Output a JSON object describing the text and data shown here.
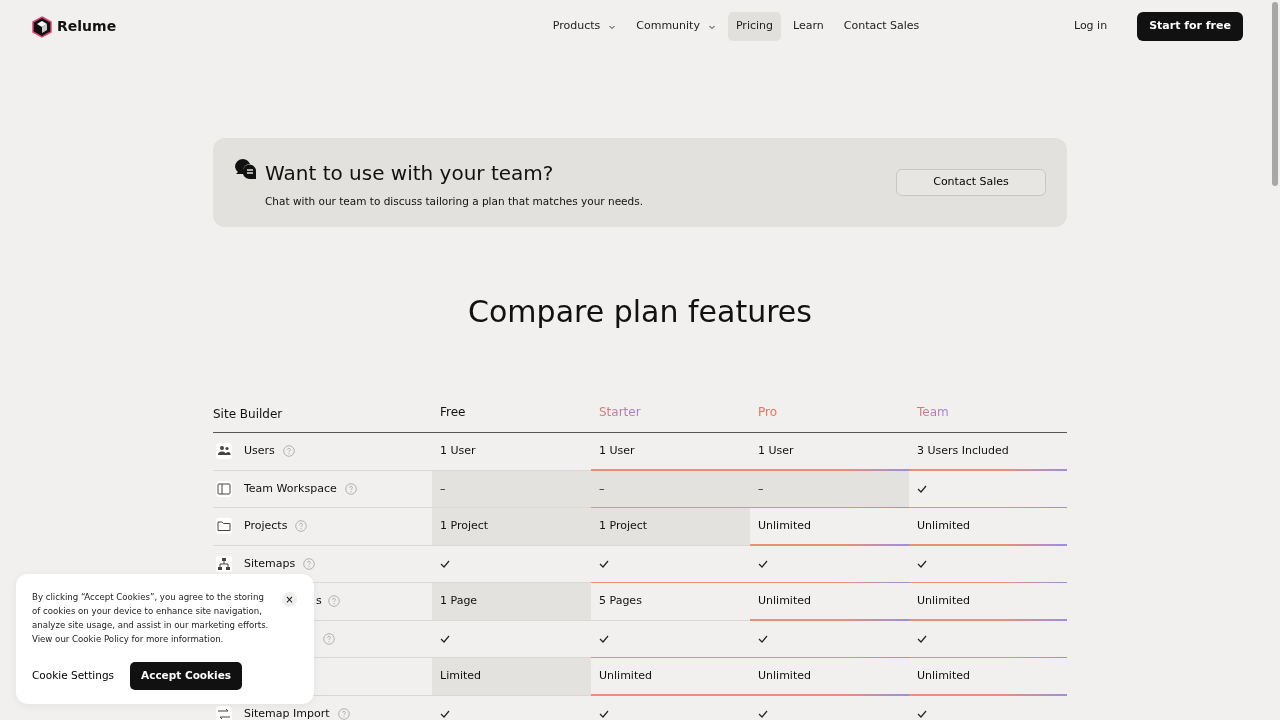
{
  "navbar": {
    "brand": "Relume",
    "links": [
      {
        "label": "Products",
        "dropdown": true,
        "selected": false
      },
      {
        "label": "Community",
        "dropdown": true,
        "selected": false
      },
      {
        "label": "Pricing",
        "dropdown": false,
        "selected": true
      },
      {
        "label": "Learn",
        "dropdown": false,
        "selected": false
      },
      {
        "label": "Contact Sales",
        "dropdown": false,
        "selected": false
      }
    ],
    "login": "Log in",
    "cta": "Start for free"
  },
  "team_banner": {
    "title": "Want to use with your team?",
    "text": "Chat with our team to discuss tailoring a plan that matches your needs.",
    "button": "Contact Sales"
  },
  "compare": {
    "title": "Compare plan features",
    "section": "Site Builder",
    "plans": [
      {
        "name": "Free",
        "kind": "plain"
      },
      {
        "name": "Starter",
        "kind": "starter"
      },
      {
        "name": "Pro",
        "kind": "pro"
      },
      {
        "name": "Team",
        "kind": "team"
      }
    ],
    "rows": [
      {
        "label": "Users",
        "help": true,
        "cells": [
          {
            "value": "1 User",
            "shaded": false,
            "accent": false
          },
          {
            "value": "1 User",
            "shaded": false,
            "accent": true
          },
          {
            "value": "1 User",
            "shaded": false,
            "accent": true
          },
          {
            "value": "3 Users Included",
            "shaded": false,
            "accent": true
          }
        ]
      },
      {
        "label": "Team Workspace",
        "help": true,
        "cells": [
          {
            "value": "–",
            "shaded": true,
            "accent": false
          },
          {
            "value": "–",
            "shaded": true,
            "accent": true
          },
          {
            "value": "–",
            "shaded": true,
            "accent": true
          },
          {
            "check": true,
            "shaded": false,
            "accent": true
          }
        ]
      },
      {
        "label": "Projects",
        "help": true,
        "cells": [
          {
            "value": "1 Project",
            "shaded": true,
            "accent": false
          },
          {
            "value": "1 Project",
            "shaded": true,
            "accent": false
          },
          {
            "value": "Unlimited",
            "shaded": false,
            "accent": true
          },
          {
            "value": "Unlimited",
            "shaded": false,
            "accent": true
          }
        ]
      },
      {
        "label": "Sitemaps",
        "help": true,
        "cells": [
          {
            "check": true,
            "shaded": false,
            "accent": false
          },
          {
            "check": true,
            "shaded": false,
            "accent": true
          },
          {
            "check": true,
            "shaded": false,
            "accent": true
          },
          {
            "check": true,
            "shaded": false,
            "accent": true
          }
        ]
      },
      {
        "label": "s",
        "help": true,
        "cells": [
          {
            "value": "1 Page",
            "shaded": true,
            "accent": false
          },
          {
            "value": "5 Pages",
            "shaded": false,
            "accent": false
          },
          {
            "value": "Unlimited",
            "shaded": false,
            "accent": true
          },
          {
            "value": "Unlimited",
            "shaded": false,
            "accent": true
          }
        ]
      },
      {
        "help": true,
        "cells": [
          {
            "check": true,
            "shaded": false,
            "accent": false
          },
          {
            "check": true,
            "shaded": false,
            "accent": true
          },
          {
            "check": true,
            "shaded": false,
            "accent": true
          },
          {
            "check": true,
            "shaded": false,
            "accent": true
          }
        ]
      },
      {
        "cells": [
          {
            "value": "Limited",
            "shaded": true,
            "accent": false
          },
          {
            "value": "Unlimited",
            "shaded": false,
            "accent": true
          },
          {
            "value": "Unlimited",
            "shaded": false,
            "accent": true
          },
          {
            "value": "Unlimited",
            "shaded": false,
            "accent": true
          }
        ]
      },
      {
        "label": "Sitemap Import",
        "help": true,
        "cells": [
          {
            "check": true,
            "shaded": false
          },
          {
            "check": true,
            "shaded": false
          },
          {
            "check": true,
            "shaded": false
          },
          {
            "check": true,
            "shaded": false
          }
        ]
      }
    ]
  },
  "cookie_banner": {
    "text": "By clicking “Accept Cookies”, you agree to the storing of cookies on your device to enhance site navigation, analyze site usage, and assist in our marketing efforts. View our Cookie Policy for more information.",
    "close": "×",
    "settings": "Cookie Settings",
    "accept": "Accept Cookies"
  }
}
